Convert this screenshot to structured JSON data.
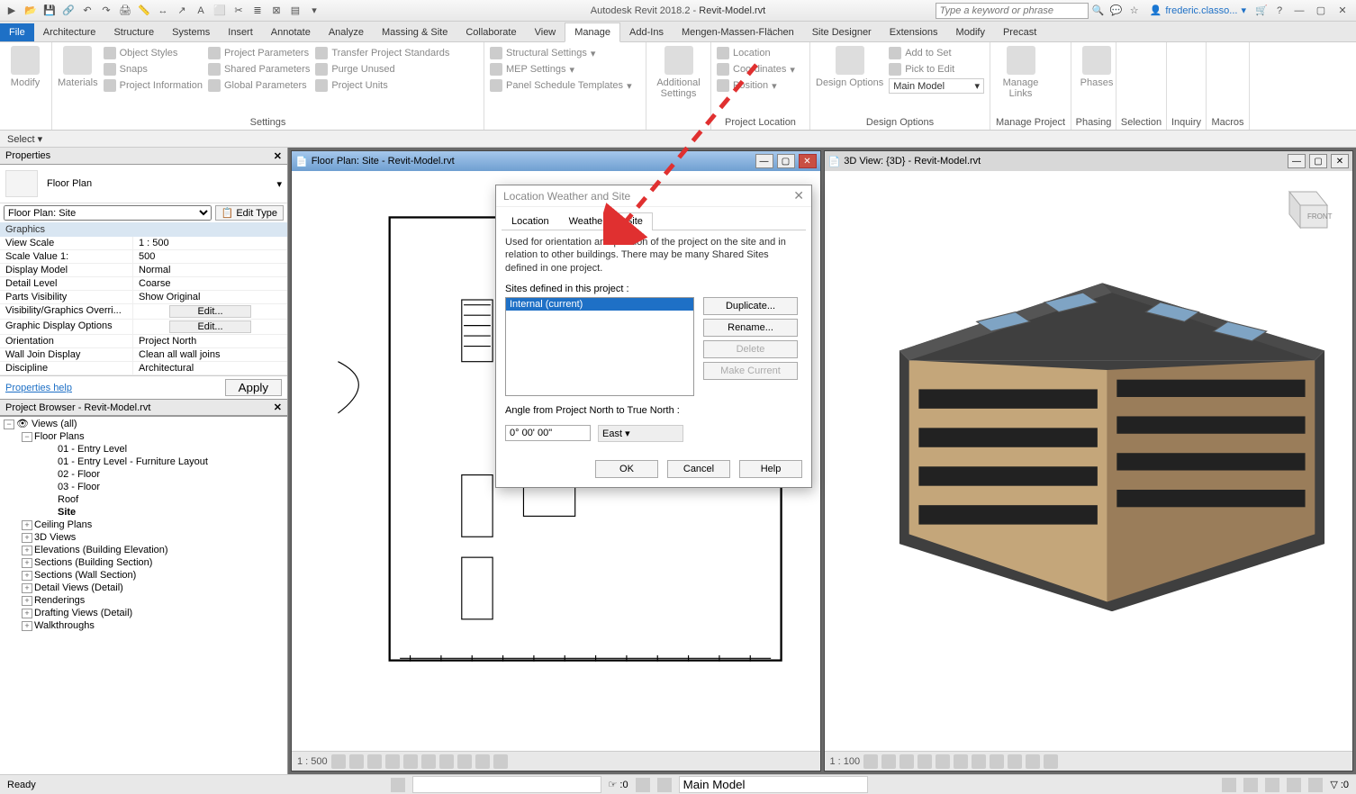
{
  "titlebar": {
    "app": "Autodesk Revit 2018.2",
    "sep": "-",
    "doc": "Revit-Model.rvt",
    "search_placeholder": "Type a keyword or phrase",
    "user": "frederic.classo...",
    "help": "?"
  },
  "tabs": [
    "File",
    "Architecture",
    "Structure",
    "Systems",
    "Insert",
    "Annotate",
    "Analyze",
    "Massing & Site",
    "Collaborate",
    "View",
    "Manage",
    "Add-Ins",
    "Mengen-Massen-Flächen",
    "Site Designer",
    "Extensions",
    "Modify",
    "Precast"
  ],
  "active_tab": "Manage",
  "ribbon": {
    "selection": {
      "label": "",
      "modify": "Modify"
    },
    "materials": "Materials",
    "settings_col1": [
      "Object  Styles",
      "Snaps",
      "Project  Information"
    ],
    "settings_col2": [
      "Project  Parameters",
      "Shared  Parameters",
      "Global  Parameters"
    ],
    "settings_col3": [
      "Transfer  Project Standards",
      "Purge  Unused",
      "Project  Units"
    ],
    "settings_col4": [
      "Structural  Settings",
      "MEP  Settings",
      "Panel Schedule  Templates"
    ],
    "additional_settings": "Additional Settings",
    "settings_panel": "Settings",
    "location": "Location",
    "coordinates": "Coordinates",
    "position": "Position",
    "project_location_panel": "Project Location",
    "design_options": "Design Options",
    "add_to_set": "Add to Set",
    "pick_to_edit": "Pick to Edit",
    "main_model": "Main Model",
    "design_options_panel": "Design Options",
    "manage_links": "Manage Links",
    "manage_project_panel": "Manage Project",
    "phases": "Phases",
    "phasing_panel": "Phasing",
    "selection_panel": "Selection",
    "inquiry_panel": "Inquiry",
    "macros_panel": "Macros"
  },
  "select_row": "Select ▾",
  "properties": {
    "title": "Properties",
    "type_name": "Floor Plan",
    "view_combo": "Floor Plan: Site",
    "edit_type": "Edit Type",
    "cat": "Graphics",
    "rows": [
      {
        "k": "View Scale",
        "v": "1 : 500"
      },
      {
        "k": "Scale Value    1:",
        "v": "500"
      },
      {
        "k": "Display Model",
        "v": "Normal"
      },
      {
        "k": "Detail Level",
        "v": "Coarse"
      },
      {
        "k": "Parts Visibility",
        "v": "Show Original"
      },
      {
        "k": "Visibility/Graphics Overri...",
        "v": "Edit..."
      },
      {
        "k": "Graphic Display Options",
        "v": "Edit..."
      },
      {
        "k": "Orientation",
        "v": "Project North"
      },
      {
        "k": "Wall Join Display",
        "v": "Clean all wall joins"
      },
      {
        "k": "Discipline",
        "v": "Architectural"
      }
    ],
    "help": "Properties help",
    "apply": "Apply"
  },
  "browser": {
    "title": "Project Browser - Revit-Model.rvt",
    "root": "Views (all)",
    "floorplans_label": "Floor Plans",
    "floorplans": [
      "01 - Entry Level",
      "01 - Entry Level - Furniture Layout",
      "02 - Floor",
      "03 - Floor",
      "Roof",
      "Site"
    ],
    "other": [
      "Ceiling Plans",
      "3D Views",
      "Elevations (Building Elevation)",
      "Sections (Building Section)",
      "Sections (Wall Section)",
      "Detail Views (Detail)",
      "Renderings",
      "Drafting Views (Detail)",
      "Walkthroughs"
    ]
  },
  "views": {
    "floor": {
      "title": "Floor Plan: Site - Revit-Model.rvt",
      "scale": "1 : 500"
    },
    "three": {
      "title": "3D View: {3D} - Revit-Model.rvt",
      "scale": "1 : 100"
    }
  },
  "dialog": {
    "title": "Location Weather and Site",
    "tabs": [
      "Location",
      "Weather",
      "Site"
    ],
    "active_tab": "Site",
    "desc": "Used for orientation and position of the project on the site and in relation to other buildings. There may be many Shared Sites defined in one project.",
    "sites_label": "Sites defined in this project :",
    "site_item": "Internal (current)",
    "duplicate": "Duplicate...",
    "rename": "Rename...",
    "delete": "Delete",
    "make_current": "Make Current",
    "angle_label": "Angle from Project North to True North :",
    "angle_value": "0° 00' 00\"",
    "direction": "East",
    "ok": "OK",
    "cancel": "Cancel",
    "help": "Help"
  },
  "statusbar": {
    "ready": "Ready",
    "zero": ":0",
    "main_model": "Main Model"
  }
}
